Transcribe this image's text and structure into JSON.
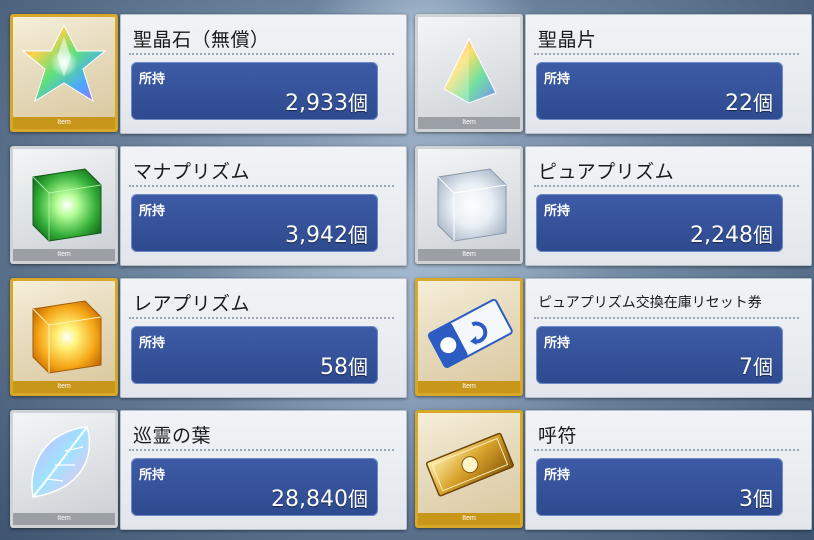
{
  "tag_label": "Item",
  "owned_label": "所持",
  "unit": "個",
  "items": [
    {
      "name": "聖晶石（無償）",
      "quantity": "2,933",
      "frame": "gold",
      "icon": "saint-quartz-icon"
    },
    {
      "name": "聖晶片",
      "quantity": "22",
      "frame": "silver",
      "icon": "quartz-fragment-icon"
    },
    {
      "name": "マナプリズム",
      "quantity": "3,942",
      "frame": "silver",
      "icon": "mana-prism-icon"
    },
    {
      "name": "ピュアプリズム",
      "quantity": "2,248",
      "frame": "silver",
      "icon": "pure-prism-icon"
    },
    {
      "name": "レアプリズム",
      "quantity": "58",
      "frame": "gold",
      "icon": "rare-prism-icon"
    },
    {
      "name": "ピュアプリズム交換在庫リセット券",
      "quantity": "7",
      "frame": "gold",
      "icon": "reset-ticket-icon"
    },
    {
      "name": "巡霊の葉",
      "quantity": "28,840",
      "frame": "silver",
      "icon": "spirit-leaf-icon"
    },
    {
      "name": "呼符",
      "quantity": "3",
      "frame": "gold",
      "icon": "summon-ticket-icon"
    }
  ]
}
